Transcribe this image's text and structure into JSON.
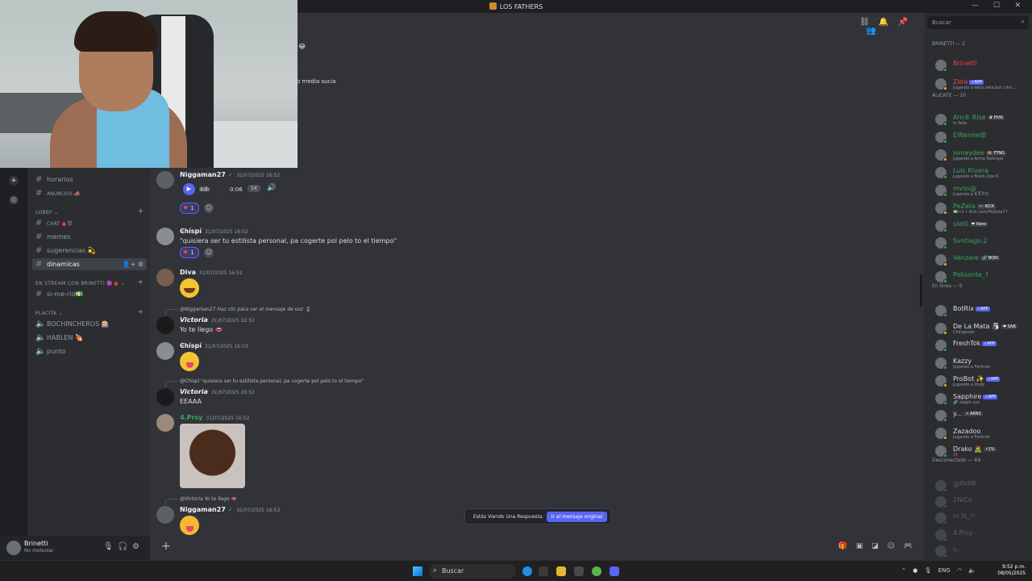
{
  "window": {
    "title": "LOS FATHERS",
    "controls": [
      "—",
      "☐",
      "✕"
    ]
  },
  "rail": {
    "add_server_icon": "plus-icon",
    "explore_icon": "compass-icon"
  },
  "sidebar": {
    "channels_top": [
      {
        "name": "horarios"
      },
      {
        "name": "ANUNCIOS 📣"
      }
    ],
    "lobby_label": "LOBBY",
    "lobby_channels": [
      {
        "name": "CHAT 🩸😈"
      },
      {
        "name": "memes"
      },
      {
        "name": "sugerencias 💫"
      },
      {
        "name": "dinamicas"
      }
    ],
    "stream_label": "EN STREAM CON BRINETTI 🟣🩸",
    "stream_channels": [
      {
        "name": "si-me-rio💵"
      }
    ],
    "placita_label": "PLACITA",
    "voice_channels": [
      {
        "name": "BOCHINCHEROS 🎰"
      },
      {
        "name": "HABLEN 🍖"
      },
      {
        "name": "punto"
      }
    ]
  },
  "user": {
    "name": "Brinetti",
    "status": "No molestar"
  },
  "partial_texts": {
    "behind_cam_1": "😂",
    "behind_cam_2": "o media sucia"
  },
  "messages": [
    {
      "author": "Niggaman27",
      "time": "31/07/2025 16:52",
      "voice": {
        "duration": "0:06",
        "speed": "1X"
      },
      "reaction": "1"
    },
    {
      "author": "Ͼհíspí",
      "time": "31/07/2025 16:52",
      "text": "\"quisiera ser tu estilista personal, pa cogerte pol pelo to el tiempo\"",
      "reaction": "1"
    },
    {
      "author": "Diva",
      "time": "31/07/2025 16:52"
    },
    {
      "reply_to": "@Niggaman27 Haz clic para ver el mensaje de voz 🎙",
      "author": "Victoria",
      "time": "31/07/2025 16:53",
      "text": "Yo te llego 👄"
    },
    {
      "author": "Ͼհíspí",
      "time": "31/07/2025 16:53"
    },
    {
      "reply_to": "@Ͼհíspí \"quisiera ser tu estilista personal, pa cogerte pol pelo to el tiempo\"",
      "author": "Victoria",
      "time": "31/07/2025 16:53",
      "text": "EEAAA"
    },
    {
      "author": "4.Prsy",
      "time": "31/07/2025 16:53"
    },
    {
      "reply_to": "@Victoria Yo te llego 👄",
      "author": "Niggaman27",
      "time": "31/07/2025 16:53"
    }
  ],
  "reply_toast": {
    "text": "Estás Viendo Una Respuesta.",
    "button": "Ir al mensaje original"
  },
  "search": {
    "placeholder": "Buscar"
  },
  "members": {
    "groups": [
      {
        "label": "BRINETTI — 2"
      },
      {
        "label": "ALICATE — 10"
      },
      {
        "label": "En línea — 9"
      },
      {
        "label": "Desconectado — 69"
      }
    ],
    "list": [
      {
        "name": "Brinetti",
        "activity": "",
        "tag": "",
        "color": "#ed4245"
      },
      {
        "name": "Zeta",
        "activity": "Jugando a decs.zeta.bot | dsc...",
        "tag": "✓APP",
        "color": "#ed4245"
      },
      {
        "name": "Am® Rise",
        "activity": "tv fella",
        "tag": "♛ HVN",
        "color": "#3ba55d"
      },
      {
        "name": "ElNenne😡",
        "activity": "",
        "tag": "",
        "color": "#3ba55d"
      },
      {
        "name": "ismaydee",
        "activity": "Jugando a Arma Reforger",
        "tag": "🐝 FTNG",
        "color": "#3ba55d"
      },
      {
        "name": "Luis Rivera",
        "activity": "Jugando a Black Ops 6",
        "tag": "",
        "color": "#3ba55d"
      },
      {
        "name": "mvss@__",
        "activity": "Jugando a R.E.P.O.",
        "tag": "",
        "color": "#3ba55d"
      },
      {
        "name": "PeZeta",
        "activity": "💵+2 • Kick.com/PeZeta77",
        "tag": "🎮 KICK",
        "color": "#3ba55d"
      },
      {
        "name": "slatii",
        "activity": "",
        "tag": "❤ Xeno",
        "color": "#3ba55d"
      },
      {
        "name": "Svntiago.2",
        "activity": "",
        "tag": "",
        "color": "#3ba55d"
      },
      {
        "name": "Venzare",
        "activity": "",
        "tag": "🔗 BORI",
        "color": "#3ba55d"
      },
      {
        "name": "Polisonte_†",
        "activity": "",
        "tag": "",
        "color": "#3ba55d"
      },
      {
        "name": "BotRix",
        "activity": "",
        "tag": "✓APP",
        "color": "#dbdee1"
      },
      {
        "name": "De La Mata 🎳",
        "activity": "Chingando",
        "tag": "❤ SAB",
        "color": "#dbdee1"
      },
      {
        "name": "FreshTok",
        "activity": "",
        "tag": "✓APP",
        "color": "#dbdee1"
      },
      {
        "name": "Kazzy",
        "activity": "Jugando a Fortnite",
        "tag": "",
        "color": "#dbdee1"
      },
      {
        "name": "ProBot ✨",
        "activity": "Jugando a /help",
        "tag": "✓APP",
        "color": "#dbdee1"
      },
      {
        "name": "Sapphire",
        "activity": "🔗 sapph.xyz",
        "tag": "✓APP",
        "color": "#dbdee1"
      },
      {
        "name": "y...",
        "activity": "",
        "tag": "↗ AKNS",
        "color": "#dbdee1"
      },
      {
        "name": "Zazadoo",
        "activity": "Jugando a Fortnite",
        "tag": "",
        "color": "#dbdee1"
      },
      {
        "name": "Drako 🧟",
        "activity": "💢",
        "tag": "⚡1%",
        "color": "#dbdee1"
      },
      {
        "name": "@RVPR",
        "activity": "",
        "tag": "",
        "color": "#5c5f66"
      },
      {
        "name": "2NiCo",
        "activity": "",
        "tag": "",
        "color": "#5c5f66"
      },
      {
        "name": "l<3t_!!",
        "activity": "",
        "tag": "",
        "color": "#5c5f66"
      },
      {
        "name": "4.Prsy",
        "activity": "",
        "tag": "",
        "color": "#5c5f66"
      },
      {
        "name": "s...",
        "activity": "",
        "tag": "",
        "color": "#5c5f66"
      }
    ]
  },
  "taskbar": {
    "search": "Buscar",
    "lang": "ENG",
    "time": "9:52 p.m.",
    "date": "08/05/2025"
  }
}
